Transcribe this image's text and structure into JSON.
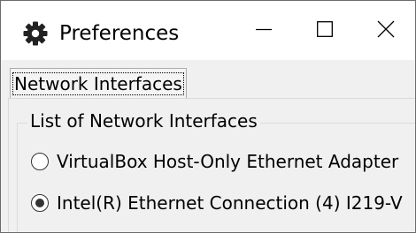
{
  "window": {
    "title": "Preferences",
    "icon": "gear-icon",
    "controls": {
      "minimize": "minimize-icon",
      "maximize": "maximize-icon",
      "close": "close-icon"
    }
  },
  "tabs": [
    {
      "label": "Network Interfaces",
      "selected": true
    }
  ],
  "network_interfaces": {
    "group_title": "List of Network Interfaces",
    "options": [
      {
        "label": "VirtualBox Host-Only Ethernet Adapter",
        "selected": false
      },
      {
        "label": "Intel(R) Ethernet Connection (4) I219-V",
        "selected": true
      }
    ]
  },
  "colors": {
    "titlebar_bg": "#ffffff",
    "window_bg": "#f0f0f0",
    "close_hover": "#e81123"
  }
}
